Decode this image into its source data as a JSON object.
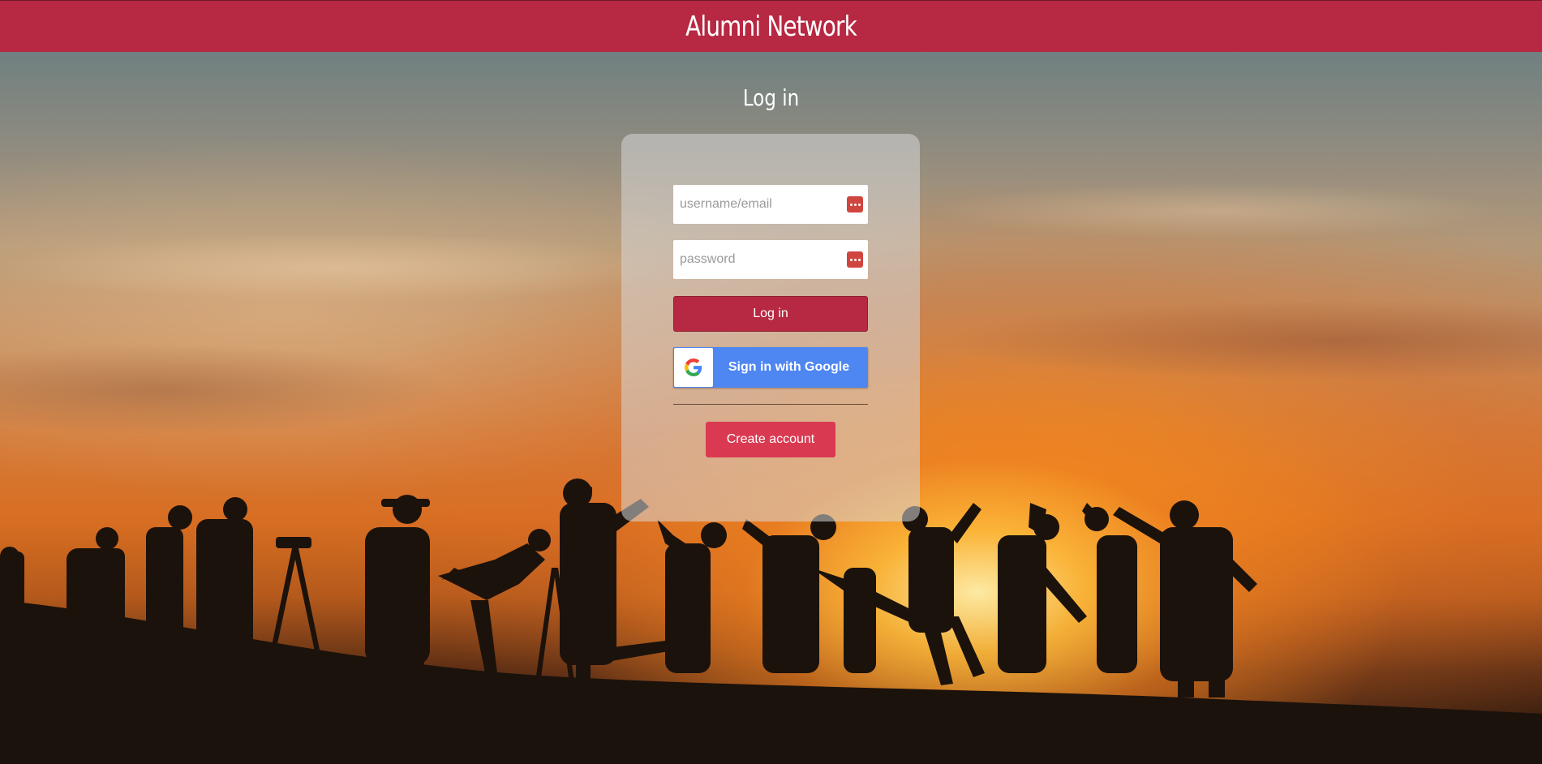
{
  "header": {
    "title": "Alumni Network"
  },
  "page": {
    "title": "Log in"
  },
  "login_form": {
    "username_placeholder": "username/email",
    "username_value": "",
    "password_placeholder": "password",
    "password_value": "",
    "field_icon": "password-manager-icon",
    "login_label": "Log in",
    "google_label": "Sign in with Google",
    "google_icon": "google-g-icon",
    "create_account_label": "Create account"
  },
  "colors": {
    "brand": "#b72842",
    "create_button": "#d93a52",
    "google_blue": "#4e86f2",
    "field_icon": "#d0463f"
  },
  "background": {
    "scene": "sunset-silhouettes"
  }
}
